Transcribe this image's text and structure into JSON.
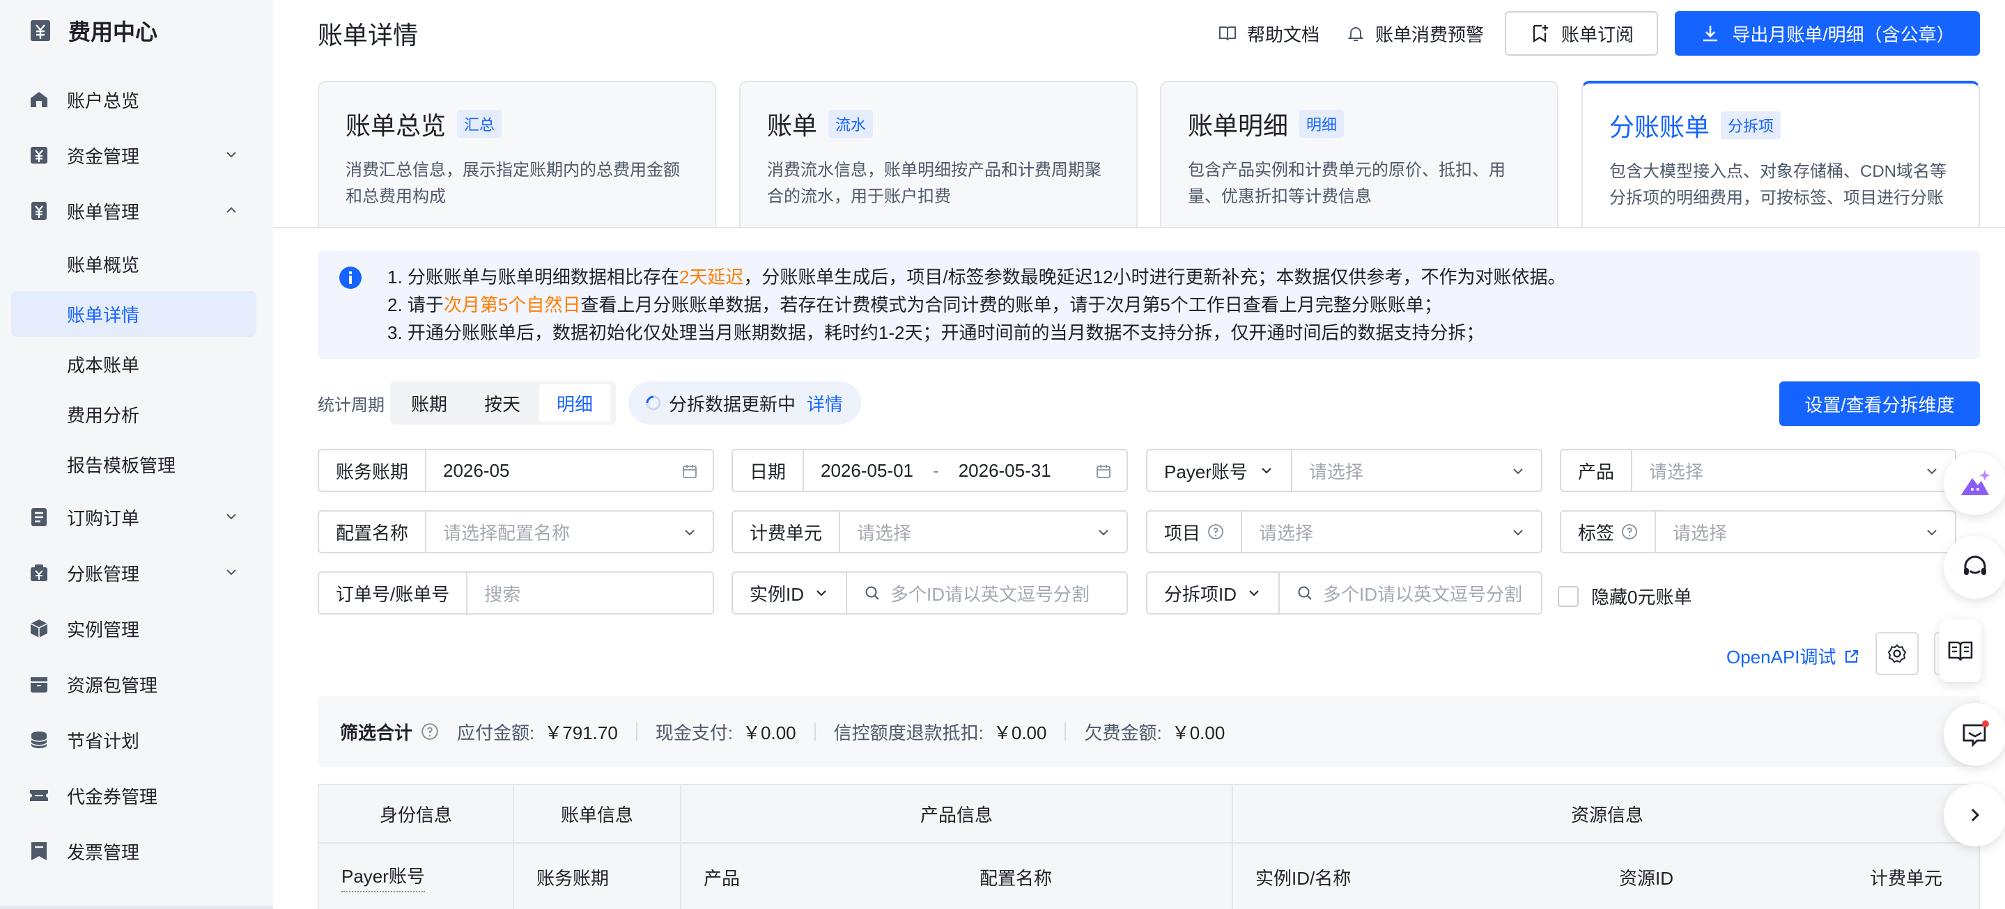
{
  "sidebar": {
    "title": "费用中心",
    "items": [
      {
        "label": "账户总览"
      },
      {
        "label": "资金管理"
      },
      {
        "label": "账单管理"
      },
      {
        "label": "订购订单"
      },
      {
        "label": "分账管理"
      },
      {
        "label": "实例管理"
      },
      {
        "label": "资源包管理"
      },
      {
        "label": "节省计划"
      },
      {
        "label": "代金券管理"
      },
      {
        "label": "发票管理"
      }
    ],
    "sub_items": [
      {
        "label": "账单概览"
      },
      {
        "label": "账单详情"
      },
      {
        "label": "成本账单"
      },
      {
        "label": "费用分析"
      },
      {
        "label": "报告模板管理"
      }
    ]
  },
  "header": {
    "title": "账单详情",
    "help": "帮助文档",
    "alert": "账单消费预警",
    "subscribe": "账单订阅",
    "export": "导出月账单/明细（含公章）"
  },
  "cards": [
    {
      "title": "账单总览",
      "tag": "汇总",
      "desc": "消费汇总信息，展示指定账期内的总费用金额和总费用构成"
    },
    {
      "title": "账单",
      "tag": "流水",
      "desc": "消费流水信息，账单明细按产品和计费周期聚合的流水，用于账户扣费"
    },
    {
      "title": "账单明细",
      "tag": "明细",
      "desc": "包含产品实例和计费单元的原价、抵扣、用量、优惠折扣等计费信息"
    },
    {
      "title": "分账账单",
      "tag": "分拆项",
      "desc": "包含大模型接入点、对象存储桶、CDN域名等分拆项的明细费用，可按标签、项目进行分账"
    }
  ],
  "notice": {
    "l1_a": "1. 分账账单与账单明细数据相比存在",
    "l1_hl": "2天延迟",
    "l1_b": "，分账账单生成后，项目/标签参数最晚延迟12小时进行更新补充；本数据仅供参考，不作为对账依据。",
    "l2_a": "2. 请于",
    "l2_hl": "次月第5个自然日",
    "l2_b": "查看上月分账账单数据，若存在计费模式为合同计费的账单，请于次月第5个工作日查看上月完整分账账单；",
    "l3": "3. 开通分账账单后，数据初始化仅处理当月账期数据，耗时约1-2天；开通时间前的当月数据不支持分拆，仅开通时间后的数据支持分拆；"
  },
  "toolbar": {
    "period_label": "统计周期",
    "options": [
      "账期",
      "按天",
      "明细"
    ],
    "selected": "明细",
    "status": "分拆数据更新中",
    "status_link": "详情",
    "settings_button": "设置/查看分拆维度"
  },
  "filters": {
    "bill_period_label": "账务账期",
    "bill_period_value": "2026-05",
    "date_label": "日期",
    "date_start": "2026-05-01",
    "date_sep": "-",
    "date_end": "2026-05-31",
    "payer_label": "Payer账号",
    "payer_placeholder": "请选择",
    "product_label": "产品",
    "product_placeholder": "请选择",
    "config_label": "配置名称",
    "config_placeholder": "请选择配置名称",
    "unit_label": "计费单元",
    "unit_placeholder": "请选择",
    "project_label": "项目",
    "project_placeholder": "请选择",
    "tag_label": "标签",
    "tag_placeholder": "请选择",
    "order_label": "订单号/账单号",
    "order_placeholder": "搜索",
    "instance_label": "实例ID",
    "instance_placeholder": "多个ID请以英文逗号分割",
    "split_label": "分拆项ID",
    "split_placeholder": "多个ID请以英文逗号分割",
    "hide_zero": "隐藏0元账单"
  },
  "actions": {
    "openapi": "OpenAPI调试"
  },
  "summary": {
    "title": "筛选合计",
    "payable_label": "应付金额:",
    "payable_value": "￥791.70",
    "cash_label": "现金支付:",
    "cash_value": "￥0.00",
    "credit_label": "信控额度退款抵扣:",
    "credit_value": "￥0.00",
    "owed_label": "欠费金额:",
    "owed_value": "￥0.00"
  },
  "table": {
    "groups": [
      "身份信息",
      "账单信息",
      "产品信息",
      "资源信息"
    ],
    "columns": [
      "Payer账号",
      "账务账期",
      "产品",
      "配置名称",
      "实例ID/名称",
      "资源ID",
      "计费单元"
    ]
  },
  "colors": {
    "accent": "#1664ff",
    "highlight": "#ff7d00",
    "sidebar_bg": "#f5f6f8"
  }
}
